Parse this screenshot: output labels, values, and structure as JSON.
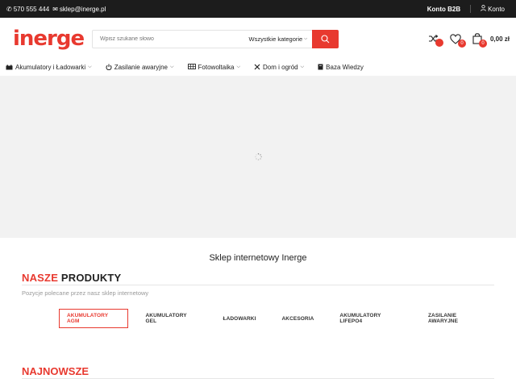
{
  "topbar": {
    "phone": "570 555 444",
    "email": "sklep@inerge.pl",
    "b2b": "Konto B2B",
    "account": "Konto"
  },
  "header": {
    "logo": "inerge",
    "search_placeholder": "Wpisz szukane słowo",
    "category": "Wszystkie kategorie",
    "compare_count": "",
    "wishlist_count": "0",
    "cart_count": "0",
    "cart_total": "0,00 zł"
  },
  "nav": [
    {
      "label": "Akumulatory i Ładowarki",
      "icon": "battery-icon",
      "dropdown": true
    },
    {
      "label": "Zasilanie awaryjne",
      "icon": "power-icon",
      "dropdown": true
    },
    {
      "label": "Fotowoltaika",
      "icon": "solar-panel-icon",
      "dropdown": true
    },
    {
      "label": "Dom i ogród",
      "icon": "tools-icon",
      "dropdown": true
    },
    {
      "label": "Baza Wiedzy",
      "icon": "book-icon",
      "dropdown": false
    }
  ],
  "content": {
    "shop_title": "Sklep internetowy Inerge",
    "products_head_red": "NASZE",
    "products_head_dark": "PRODUKTY",
    "products_sub": "Pozycje polecane przez nasz sklep internetowy",
    "tabs": [
      "AKUMULATORY AGM",
      "AKUMULATORY GEL",
      "ŁADOWARKI",
      "AKCESORIA",
      "AKUMULATORY LIFEPO4",
      "ZASILANIE AWARYJNE"
    ],
    "active_tab": "AKUMULATORY AGM",
    "newest_head": "NAJNOWSZE"
  },
  "colors": {
    "accent": "#e8392f",
    "topbar": "#1c1c1c",
    "hero_bg": "#f2f2f2"
  }
}
